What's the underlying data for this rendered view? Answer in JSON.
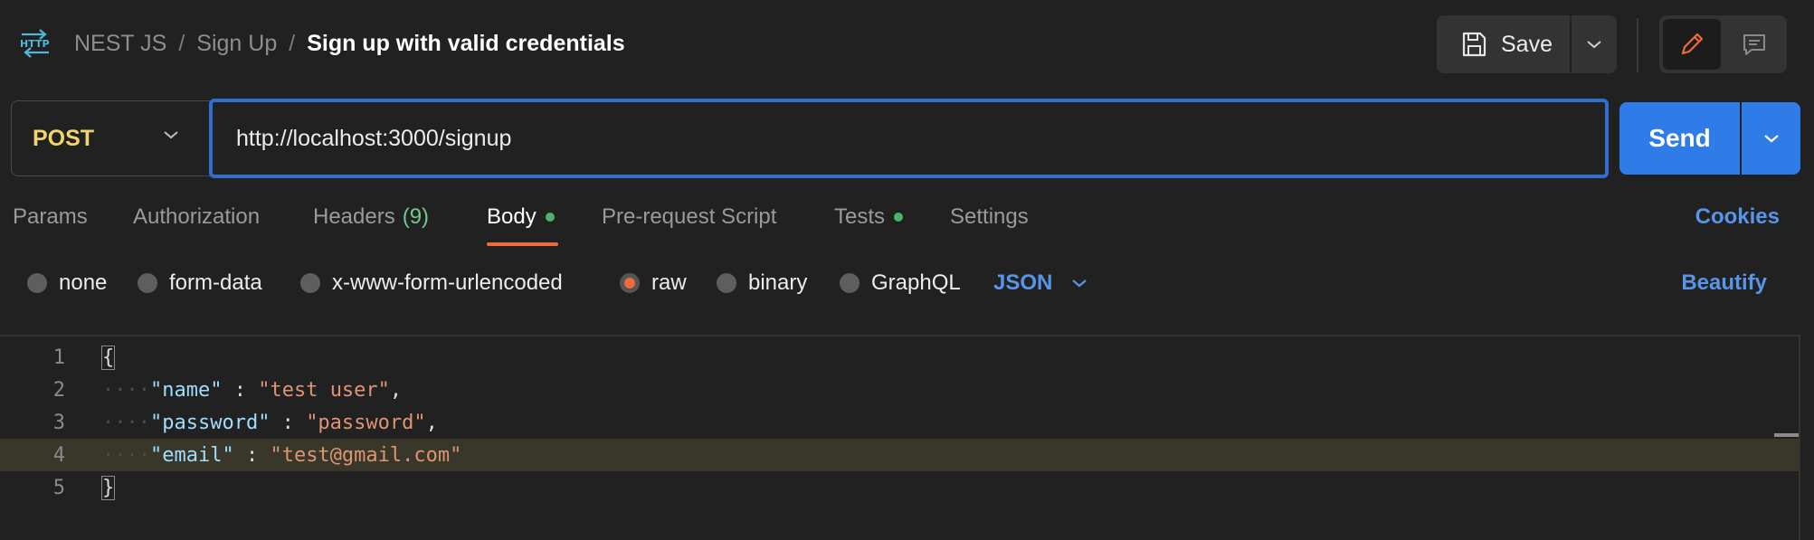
{
  "header": {
    "icon": "http-icon",
    "breadcrumb": [
      "NEST JS",
      "Sign Up"
    ],
    "breadcrumb_separator": "/",
    "current": "Sign up with valid credentials",
    "save_label": "Save"
  },
  "request": {
    "method": "POST",
    "url": "http://localhost:3000/signup",
    "send_label": "Send"
  },
  "tabs": {
    "items": [
      {
        "label": "Params"
      },
      {
        "label": "Authorization"
      },
      {
        "label": "Headers",
        "count": "(9)"
      },
      {
        "label": "Body",
        "active": true,
        "indicator": true
      },
      {
        "label": "Pre-request Script"
      },
      {
        "label": "Tests",
        "indicator": true
      },
      {
        "label": "Settings"
      }
    ],
    "cookies": "Cookies"
  },
  "body_types": {
    "options": [
      "none",
      "form-data",
      "x-www-form-urlencoded",
      "raw",
      "binary",
      "GraphQL"
    ],
    "selected": "raw",
    "language": "JSON",
    "beautify": "Beautify"
  },
  "editor": {
    "line_numbers": [
      "1",
      "2",
      "3",
      "4",
      "5"
    ],
    "lines": [
      {
        "brace": "{"
      },
      {
        "key": "\"name\"",
        "colon": " : ",
        "value": "\"test user\"",
        "trail": ","
      },
      {
        "key": "\"password\"",
        "colon": " : ",
        "value": "\"password\"",
        "trail": ","
      },
      {
        "key": "\"email\"",
        "colon": " : ",
        "value": "\"test@gmail.com\"",
        "trail": ""
      },
      {
        "brace": "}"
      }
    ],
    "highlighted_line": 4
  },
  "colors": {
    "accent_blue": "#2f7be8",
    "method_yellow": "#f2d36c",
    "active_orange": "#ef6a3c",
    "indicator_green": "#49b46a"
  }
}
